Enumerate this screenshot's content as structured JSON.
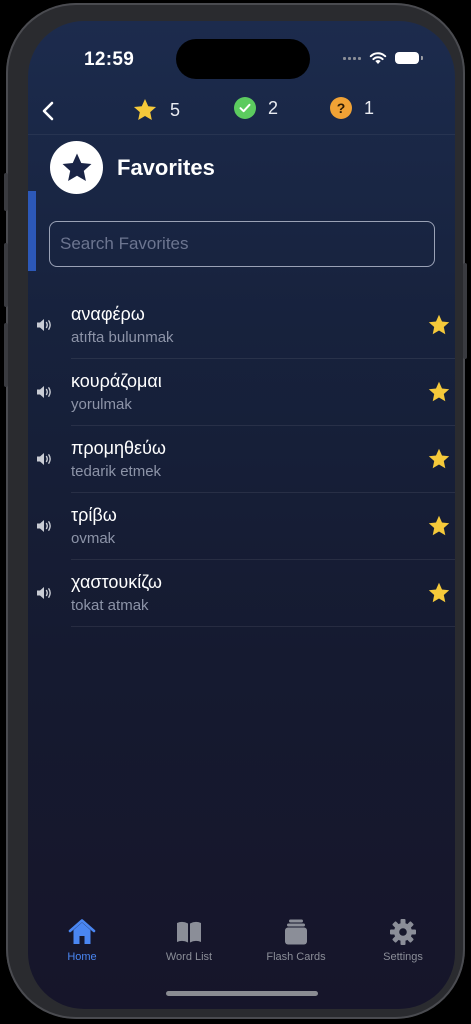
{
  "status_bar": {
    "time": "12:59"
  },
  "stats": {
    "favorites": "5",
    "correct": "2",
    "unknown": "1"
  },
  "page": {
    "title": "Favorites"
  },
  "search": {
    "placeholder": "Search Favorites",
    "value": ""
  },
  "words": [
    {
      "word": "αναφέρω",
      "translation": "atıfta bulunmak"
    },
    {
      "word": "κουράζομαι",
      "translation": "yorulmak"
    },
    {
      "word": "προμηθεύω",
      "translation": "tedarik etmek"
    },
    {
      "word": "τρίβω",
      "translation": "ovmak"
    },
    {
      "word": "χαστουκίζω",
      "translation": "tokat atmak"
    }
  ],
  "tabs": [
    {
      "label": "Home",
      "icon": "home-icon",
      "active": true
    },
    {
      "label": "Word List",
      "icon": "book-icon",
      "active": false
    },
    {
      "label": "Flash Cards",
      "icon": "cards-icon",
      "active": false
    },
    {
      "label": "Settings",
      "icon": "gear-icon",
      "active": false
    }
  ],
  "colors": {
    "accent": "#4a86f2",
    "star": "#f5c93a",
    "correct": "#5ccb5f",
    "unknown": "#f0a235",
    "background_top": "#1c2b4d",
    "background_bottom": "#16152a"
  }
}
